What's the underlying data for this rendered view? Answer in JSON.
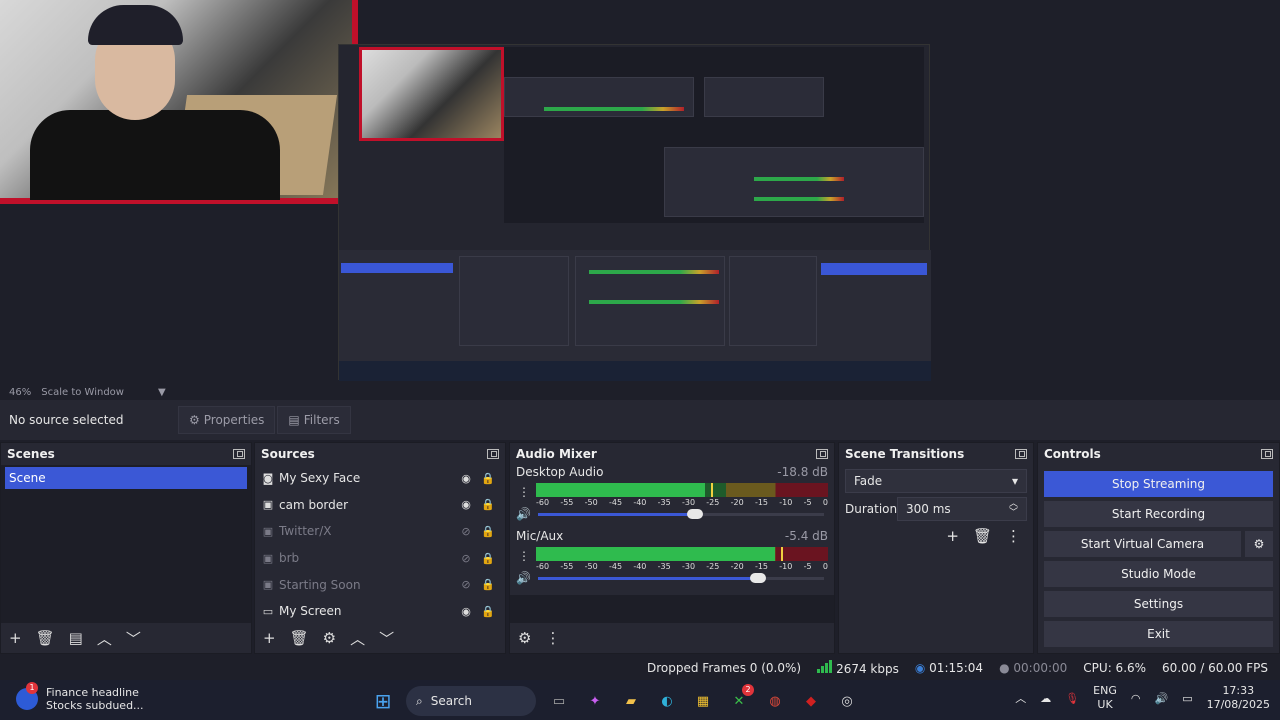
{
  "window": {
    "controls": [
      "—",
      "❐",
      "✕"
    ]
  },
  "preview": {
    "zoom": "46%",
    "scale_label": "Scale to Window"
  },
  "context": {
    "no_source": "No source selected",
    "properties": "Properties",
    "filters": "Filters"
  },
  "scenes": {
    "title": "Scenes",
    "items": [
      {
        "label": "Scene",
        "selected": true
      }
    ]
  },
  "sources": {
    "title": "Sources",
    "items": [
      {
        "label": "My Sexy Face",
        "icon": "camera-icon",
        "visible": true
      },
      {
        "label": "cam border",
        "icon": "image-icon",
        "visible": true
      },
      {
        "label": "Twitter/X",
        "icon": "image-icon",
        "visible": false
      },
      {
        "label": "brb",
        "icon": "image-icon",
        "visible": false
      },
      {
        "label": "Starting Soon",
        "icon": "image-icon",
        "visible": false
      },
      {
        "label": "My Screen",
        "icon": "monitor-icon",
        "visible": true
      }
    ]
  },
  "mixer": {
    "title": "Audio Mixer",
    "channels": [
      {
        "name": "Desktop Audio",
        "db": "-18.8 dB",
        "level": 0.58,
        "volume": 0.55
      },
      {
        "name": "Mic/Aux",
        "db": "-5.4 dB",
        "level": 0.82,
        "volume": 0.77
      }
    ],
    "ticks": [
      "-60",
      "-55",
      "-50",
      "-45",
      "-40",
      "-35",
      "-30",
      "-25",
      "-20",
      "-15",
      "-10",
      "-5",
      "0"
    ]
  },
  "transitions": {
    "title": "Scene Transitions",
    "selected": "Fade",
    "duration_label": "Duration",
    "duration_value": "300 ms"
  },
  "controls": {
    "title": "Controls",
    "stop_streaming": "Stop Streaming",
    "start_recording": "Start Recording",
    "start_virtual_camera": "Start Virtual Camera",
    "studio_mode": "Studio Mode",
    "settings": "Settings",
    "exit": "Exit"
  },
  "status": {
    "dropped_frames": "Dropped Frames 0 (0.0%)",
    "bitrate": "2674 kbps",
    "stream_time": "01:15:04",
    "record_time": "00:00:00",
    "cpu": "CPU: 6.6%",
    "fps": "60.00 / 60.00 FPS"
  },
  "taskbar": {
    "news_badge": "1",
    "news_title": "Finance headline",
    "news_sub": "Stocks subdued...",
    "search": "Search",
    "lang_top": "ENG",
    "lang_bottom": "UK",
    "time": "17:33",
    "date": "17/08/2025",
    "xbox_badge": "2"
  },
  "colors": {
    "accent": "#3b58d6",
    "red_border": "#c0102a",
    "meter_green": "#2fbb4e"
  }
}
